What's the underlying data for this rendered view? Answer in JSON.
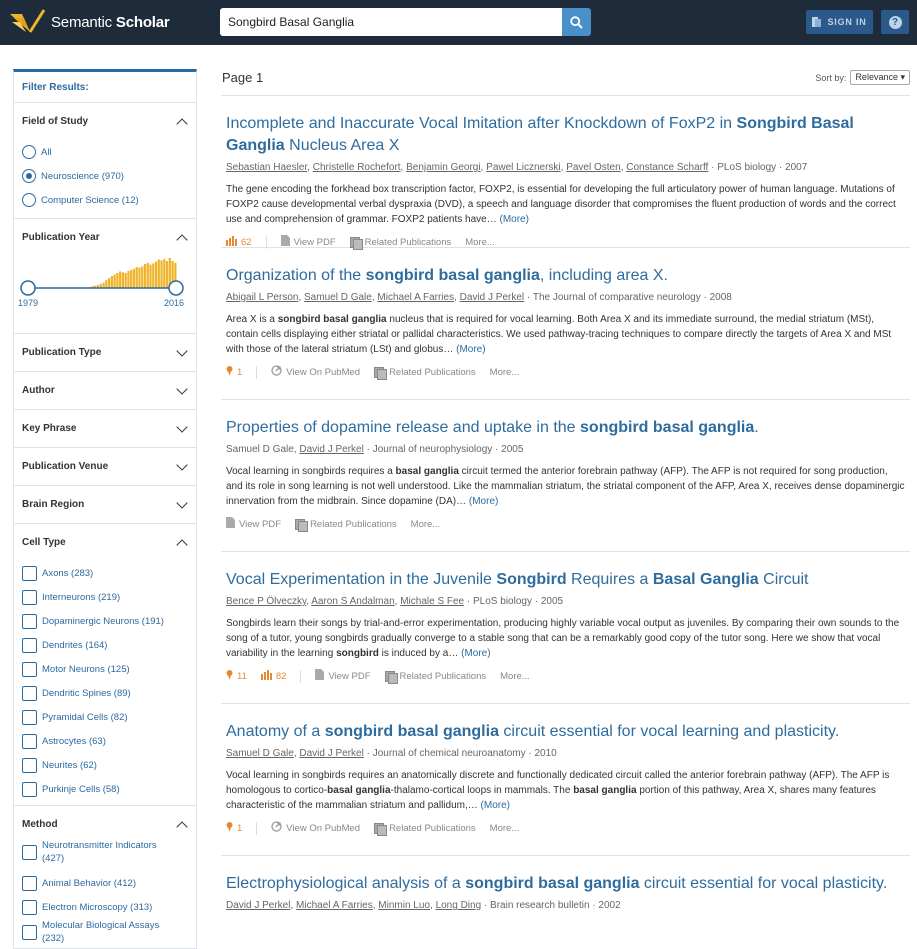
{
  "brand": {
    "name_regular": "Semantic",
    "name_bold": "Scholar"
  },
  "search": {
    "value": "Songbird Basal Ganglia"
  },
  "header": {
    "signin_label": "SIGN IN",
    "help_label": "?"
  },
  "sidebar": {
    "title": "Filter Results:",
    "field_of_study": {
      "label": "Field of Study",
      "options": [
        {
          "label": "All",
          "selected": false
        },
        {
          "label": "Neuroscience (970)",
          "selected": true
        },
        {
          "label": "Computer Science (12)",
          "selected": false
        }
      ]
    },
    "publication_year": {
      "label": "Publication Year",
      "min_label": "1979",
      "max_label": "2016",
      "bar_color": "#f0b429",
      "bars": [
        0,
        0,
        0,
        0,
        0,
        0,
        0,
        0,
        0,
        0,
        0,
        0,
        0,
        0,
        0,
        0,
        0,
        0,
        0,
        0,
        0,
        0,
        0.03,
        0.06,
        0.08,
        0.1,
        0.14,
        0.18,
        0.26,
        0.33,
        0.4,
        0.45,
        0.5,
        0.55,
        0.52,
        0.5,
        0.57,
        0.6,
        0.64,
        0.7,
        0.68,
        0.72,
        0.8,
        0.84,
        0.78,
        0.82,
        0.88,
        0.95,
        0.92,
        0.97,
        0.9,
        1.0,
        0.9,
        0.84
      ]
    },
    "collapsed_sections": [
      "Publication Type",
      "Author",
      "Key Phrase",
      "Publication Venue",
      "Brain Region"
    ],
    "cell_type": {
      "label": "Cell Type",
      "options": [
        "Axons (283)",
        "Interneurons (219)",
        "Dopaminergic Neurons (191)",
        "Dendrites (164)",
        "Motor Neurons (125)",
        "Dendritic Spines (89)",
        "Pyramidal Cells (82)",
        "Astrocytes (63)",
        "Neurites (62)",
        "Purkinje Cells (58)"
      ]
    },
    "method": {
      "label": "Method",
      "options": [
        "Neurotransmitter Indicators (427)",
        "Animal Behavior (412)",
        "Electron Microscopy (313)",
        "Molecular Biological Assays (232)"
      ]
    }
  },
  "main": {
    "page_label": "Page 1",
    "sort_label": "Sort by:",
    "sort_value": "Relevance",
    "results": [
      {
        "title": [
          {
            "t": "Incomplete and Inaccurate Vocal Imitation after Knockdown of FoxP2 in ",
            "b": false
          },
          {
            "t": "Songbird Basal Ganglia",
            "b": true
          },
          {
            "t": " Nucleus Area X",
            "b": false
          }
        ],
        "authors": [
          "Sebastian Haesler",
          "Christelle Rochefort",
          "Benjamin Georgi",
          "Pawel Licznerski",
          "Pavel Osten",
          "Constance Scharff"
        ],
        "venue": "PLoS biology",
        "year": "2007",
        "abstract": [
          {
            "t": "The gene encoding the forkhead box transcription factor, FOXP2, is essential for developing the full articulatory power of human language. Mutations of FOXP2 cause developmental verbal dyspraxia (DVD), a speech and language disorder that compromises the fluent production of words and the correct use and comprehension of grammar. FOXP2 patients have…",
            "b": false
          }
        ],
        "more": "(More)",
        "key_citations": null,
        "citations": "62",
        "link": "View PDF",
        "related": "Related Publications",
        "extra": "More..."
      },
      {
        "title": [
          {
            "t": "Organization of the ",
            "b": false
          },
          {
            "t": "songbird basal ganglia",
            "b": true
          },
          {
            "t": ", including area X.",
            "b": false
          }
        ],
        "authors": [
          "Abigail L Person",
          "Samuel D Gale",
          "Michael A Farries",
          "David J Perkel"
        ],
        "venue": "The Journal of comparative neurology",
        "year": "2008",
        "abstract": [
          {
            "t": "Area X is a ",
            "b": false
          },
          {
            "t": "songbird basal ganglia",
            "b": true
          },
          {
            "t": " nucleus that is required for vocal learning. Both Area X and its immediate surround, the medial striatum (MSt), contain cells displaying either striatal or pallidal characteristics. We used pathway-tracing techniques to compare directly the targets of Area X and MSt with those of the lateral striatum (LSt) and globus…",
            "b": false
          }
        ],
        "more": "(More)",
        "key_citations": "1",
        "citations": null,
        "link": "View On PubMed",
        "related": "Related Publications",
        "extra": "More..."
      },
      {
        "title": [
          {
            "t": "Properties of dopamine release and uptake in the ",
            "b": false
          },
          {
            "t": "songbird basal ganglia",
            "b": true
          },
          {
            "t": ".",
            "b": false
          }
        ],
        "authors_plain": "Samuel D Gale, ",
        "authors": [
          "David J Perkel"
        ],
        "venue": "Journal of neurophysiology",
        "year": "2005",
        "abstract": [
          {
            "t": "Vocal learning in songbirds requires a ",
            "b": false
          },
          {
            "t": "basal ganglia",
            "b": true
          },
          {
            "t": " circuit termed the anterior forebrain pathway (AFP). The AFP is not required for song production, and its role in song learning is not well understood. Like the mammalian striatum, the striatal component of the AFP, Area X, receives dense dopaminergic innervation from the midbrain. Since dopamine (DA)…",
            "b": false
          }
        ],
        "more": "(More)",
        "key_citations": null,
        "citations": null,
        "link": "View PDF",
        "related": "Related Publications",
        "extra": "More..."
      },
      {
        "title": [
          {
            "t": "Vocal Experimentation in the Juvenile ",
            "b": false
          },
          {
            "t": "Songbird",
            "b": true
          },
          {
            "t": " Requires a ",
            "b": false
          },
          {
            "t": "Basal Ganglia",
            "b": true
          },
          {
            "t": " Circuit",
            "b": false
          }
        ],
        "authors": [
          "Bence P Ölveczky",
          "Aaron S Andalman",
          "Michale S Fee"
        ],
        "venue": "PLoS biology",
        "year": "2005",
        "abstract": [
          {
            "t": "Songbirds learn their songs by trial-and-error experimentation, producing highly variable vocal output as juveniles. By comparing their own sounds to the song of a tutor, young songbirds gradually converge to a stable song that can be a remarkably good copy of the tutor song. Here we show that vocal variability in the learning ",
            "b": false
          },
          {
            "t": "songbird",
            "b": true
          },
          {
            "t": " is induced by a…",
            "b": false
          }
        ],
        "more": "(More)",
        "key_citations": "11",
        "citations": "82",
        "link": "View PDF",
        "related": "Related Publications",
        "extra": "More..."
      },
      {
        "title": [
          {
            "t": "Anatomy of a ",
            "b": false
          },
          {
            "t": "songbird basal ganglia",
            "b": true
          },
          {
            "t": " circuit essential for vocal learning and plasticity.",
            "b": false
          }
        ],
        "authors": [
          "Samuel D Gale",
          "David J Perkel"
        ],
        "venue": "Journal of chemical neuroanatomy",
        "year": "2010",
        "abstract": [
          {
            "t": "Vocal learning in songbirds requires an anatomically discrete and functionally dedicated circuit called the anterior forebrain pathway (AFP). The AFP is homologous to cortico-",
            "b": false
          },
          {
            "t": "basal ganglia",
            "b": true
          },
          {
            "t": "-thalamo-cortical loops in mammals. The ",
            "b": false
          },
          {
            "t": "basal ganglia",
            "b": true
          },
          {
            "t": " portion of this pathway, Area X, shares many features characteristic of the mammalian striatum and pallidum,…",
            "b": false
          }
        ],
        "more": "(More)",
        "key_citations": "1",
        "citations": null,
        "link": "View On PubMed",
        "related": "Related Publications",
        "extra": "More..."
      },
      {
        "title": [
          {
            "t": "Electrophysiological analysis of a ",
            "b": false
          },
          {
            "t": "songbird basal ganglia",
            "b": true
          },
          {
            "t": " circuit essential for vocal plasticity.",
            "b": false
          }
        ],
        "authors": [
          "David J Perkel",
          "Michael A Farries",
          "Minmin Luo",
          "Long Ding"
        ],
        "venue": "Brain research bulletin",
        "year": "2002",
        "abstract": [],
        "more": null,
        "key_citations": null,
        "citations": null,
        "link": null,
        "related": null,
        "extra": null
      }
    ]
  },
  "colors": {
    "topbar": "#1d2b3a",
    "accent": "#2f6c9e",
    "citation": "#e58a2e"
  }
}
